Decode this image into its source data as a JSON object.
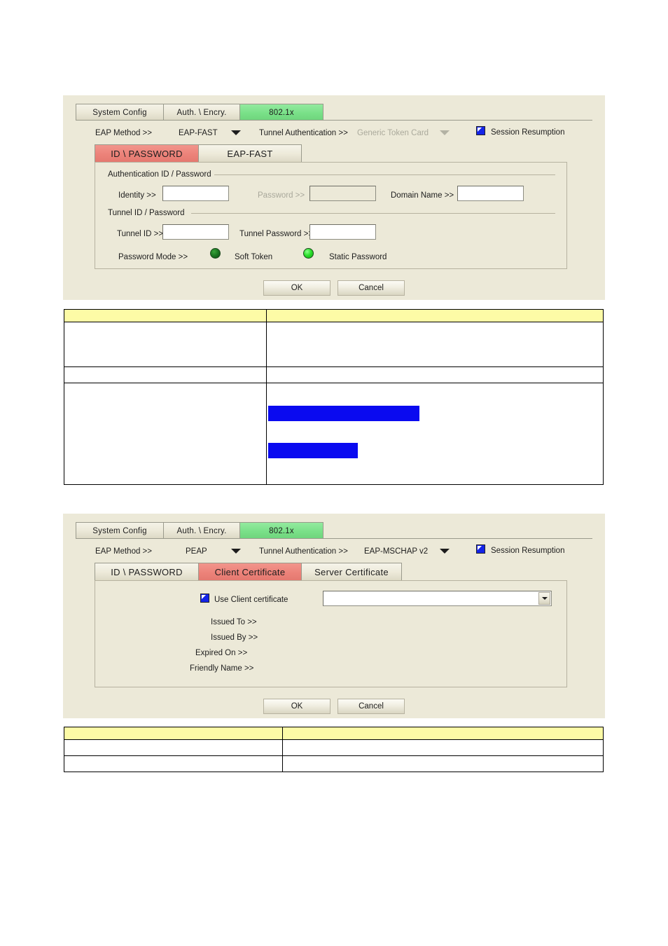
{
  "panel1": {
    "tabs": [
      {
        "label": "System Config",
        "active": false
      },
      {
        "label": "Auth. \\ Encry.",
        "active": false
      },
      {
        "label": "802.1x",
        "active": true
      }
    ],
    "eap_method_label": "EAP Method >>",
    "eap_method_value": "EAP-FAST",
    "tunnel_auth_label": "Tunnel Authentication >>",
    "tunnel_auth_value": "Generic Token Card",
    "tunnel_auth_disabled": true,
    "session_resumption_label": "Session Resumption",
    "session_resumption_checked": true,
    "inner_tabs": [
      {
        "label": "ID \\ PASSWORD",
        "active": true
      },
      {
        "label": "EAP-FAST",
        "active": false
      }
    ],
    "group_auth_label": "Authentication ID / Password",
    "identity_label": "Identity >>",
    "identity_value": "",
    "password_label": "Password >>",
    "password_value": "",
    "password_disabled": true,
    "domain_name_label": "Domain Name >>",
    "domain_name_value": "",
    "group_tunnel_label": "Tunnel ID / Password",
    "tunnel_id_label": "Tunnel ID >>",
    "tunnel_id_value": "",
    "tunnel_password_label": "Tunnel Password >>",
    "tunnel_password_value": "",
    "password_mode_label": "Password Mode >>",
    "soft_token_label": "Soft Token",
    "soft_token_selected": false,
    "static_password_label": "Static Password",
    "static_password_selected": true,
    "ok_label": "OK",
    "cancel_label": "Cancel"
  },
  "panel2": {
    "tabs": [
      {
        "label": "System Config",
        "active": false
      },
      {
        "label": "Auth. \\ Encry.",
        "active": false
      },
      {
        "label": "802.1x",
        "active": true
      }
    ],
    "eap_method_label": "EAP Method >>",
    "eap_method_value": "PEAP",
    "tunnel_auth_label": "Tunnel Authentication >>",
    "tunnel_auth_value": "EAP-MSCHAP v2",
    "session_resumption_label": "Session Resumption",
    "session_resumption_checked": true,
    "inner_tabs": [
      {
        "label": "ID \\ PASSWORD",
        "active": false
      },
      {
        "label": "Client Certificate",
        "active": true
      },
      {
        "label": "Server Certificate",
        "active": false
      }
    ],
    "use_client_cert_label": "Use Client certificate",
    "use_client_cert_checked": true,
    "cert_select_value": "",
    "issued_to_label": "Issued To >>",
    "issued_to_value": "",
    "issued_by_label": "Issued By >>",
    "issued_by_value": "",
    "expired_on_label": "Expired On >>",
    "expired_on_value": "",
    "friendly_name_label": "Friendly Name >>",
    "friendly_name_value": "",
    "ok_label": "OK",
    "cancel_label": "Cancel"
  },
  "table1": {
    "header": [
      "",
      ""
    ],
    "rows": [
      [
        "",
        ""
      ],
      [
        "",
        ""
      ],
      [
        "",
        ""
      ]
    ]
  },
  "table2": {
    "header": [
      "",
      ""
    ],
    "rows": [
      [
        "",
        ""
      ],
      [
        "",
        ""
      ]
    ]
  },
  "colors": {
    "panel_bg": "#ECE9D8",
    "tab_active_green": "#79E088",
    "tab_active_red": "#EC8279",
    "table_header_yellow": "#FDFBA6",
    "redaction_blue": "#0A0AF0",
    "checkbox_blue": "#1424E8"
  }
}
